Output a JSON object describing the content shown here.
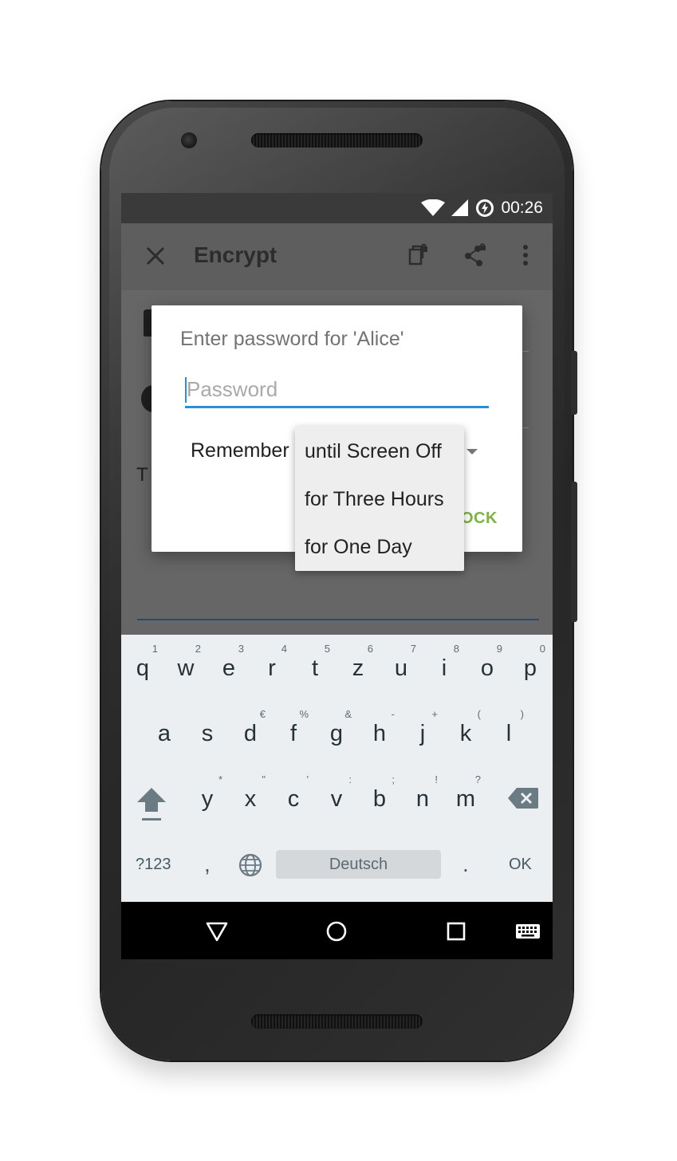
{
  "status_bar": {
    "time": "00:26",
    "icons": [
      "wifi-icon",
      "signal-icon",
      "data-saver-icon"
    ]
  },
  "toolbar": {
    "title": "Encrypt",
    "close_icon": "close-icon",
    "actions": [
      "copy-encrypted-icon",
      "share-encrypted-icon",
      "overflow-menu-icon"
    ]
  },
  "content": {
    "partial_text": "T"
  },
  "dialog": {
    "title": "Enter password for 'Alice'",
    "password_placeholder": "Password",
    "password_value": "",
    "remember_label": "Remember",
    "unlock_partial": "OCK"
  },
  "dropdown": {
    "options": [
      "until Screen Off",
      "for Three Hours",
      "for One Day"
    ],
    "selected": "until Screen Off"
  },
  "keyboard": {
    "row1": [
      {
        "k": "q",
        "h": "1"
      },
      {
        "k": "w",
        "h": "2"
      },
      {
        "k": "e",
        "h": "3"
      },
      {
        "k": "r",
        "h": "4"
      },
      {
        "k": "t",
        "h": "5"
      },
      {
        "k": "z",
        "h": "6"
      },
      {
        "k": "u",
        "h": "7"
      },
      {
        "k": "i",
        "h": "8"
      },
      {
        "k": "o",
        "h": "9"
      },
      {
        "k": "p",
        "h": "0"
      }
    ],
    "row2": [
      {
        "k": "a",
        "h": ""
      },
      {
        "k": "s",
        "h": ""
      },
      {
        "k": "d",
        "h": "€"
      },
      {
        "k": "f",
        "h": "%"
      },
      {
        "k": "g",
        "h": "&"
      },
      {
        "k": "h",
        "h": "-"
      },
      {
        "k": "j",
        "h": "+"
      },
      {
        "k": "k",
        "h": "("
      },
      {
        "k": "l",
        "h": ")"
      }
    ],
    "row3": [
      {
        "k": "y",
        "h": "*"
      },
      {
        "k": "x",
        "h": "\""
      },
      {
        "k": "c",
        "h": "'"
      },
      {
        "k": "v",
        "h": ":"
      },
      {
        "k": "b",
        "h": ";"
      },
      {
        "k": "n",
        "h": "!"
      },
      {
        "k": "m",
        "h": "?"
      }
    ],
    "symbols_key": "?123",
    "comma_key": ",",
    "space_label": "Deutsch",
    "period_key": ".",
    "ok_key": "OK"
  },
  "navigation_bar": {
    "buttons": [
      "back-icon",
      "home-icon",
      "recents-icon",
      "keyboard-switch-icon"
    ]
  },
  "colors": {
    "accent": "#2b8fd6",
    "positive_button": "#7cb342",
    "dim_background": "#5f5f5f",
    "keyboard_background": "#eceff1"
  }
}
